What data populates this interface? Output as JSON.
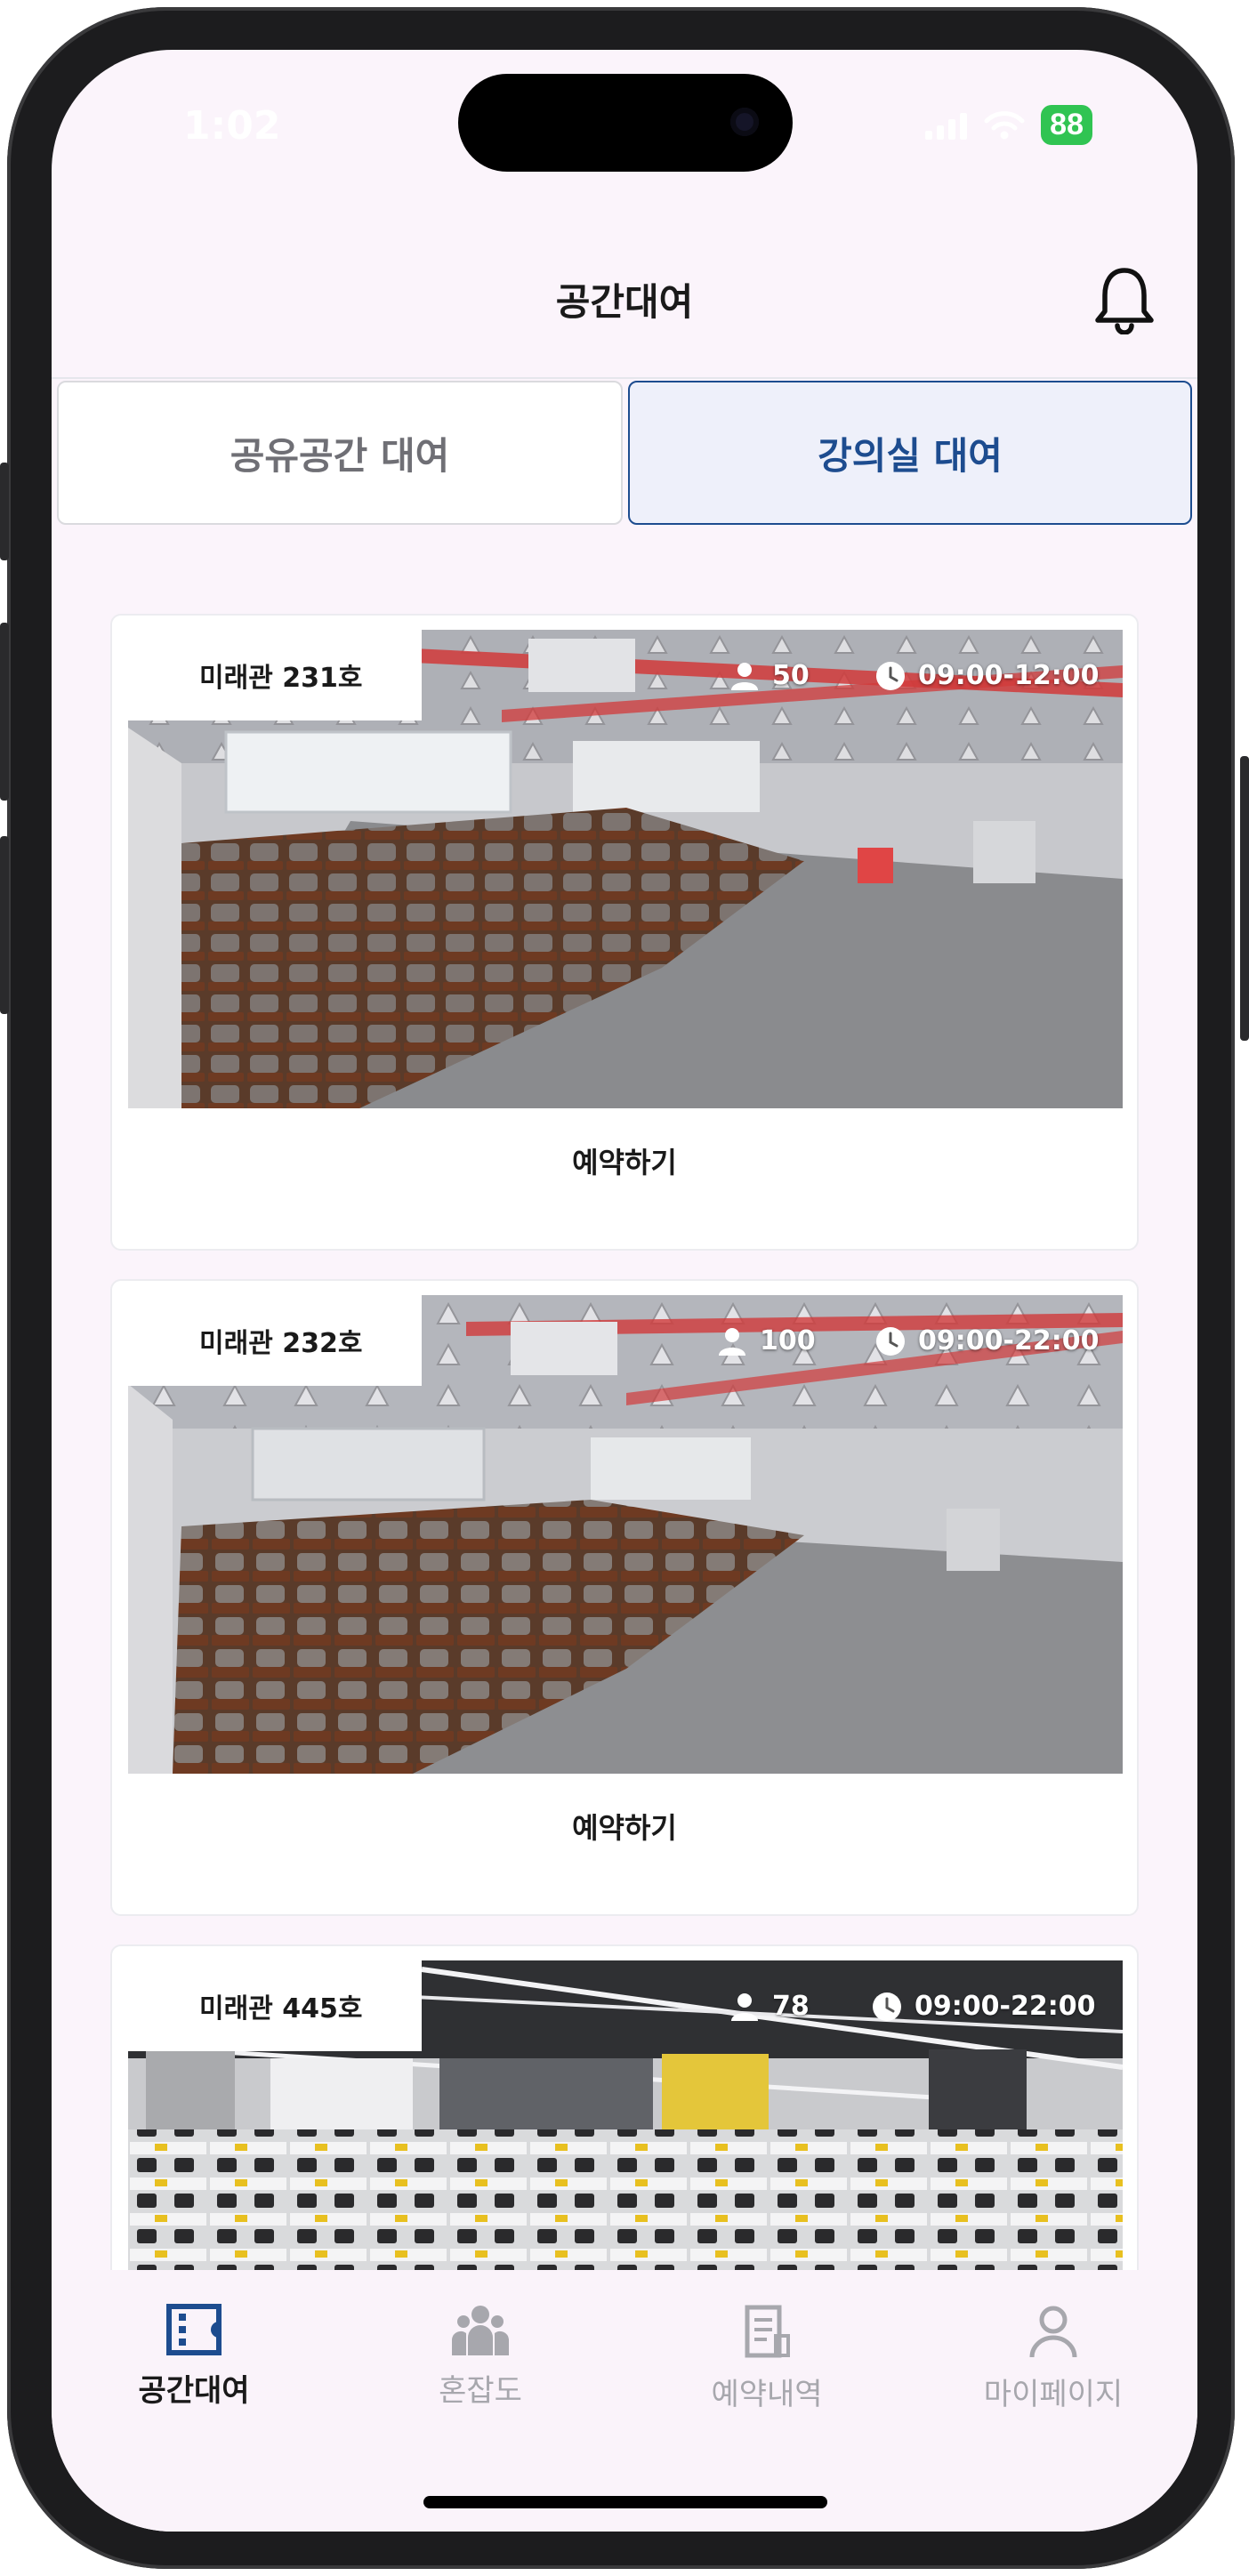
{
  "status": {
    "time": "1:02",
    "battery": "88"
  },
  "header": {
    "title": "공간대여"
  },
  "tabs": [
    {
      "label": "공유공간 대여",
      "active": false
    },
    {
      "label": "강의실 대여",
      "active": true
    }
  ],
  "rooms": [
    {
      "name": "미래관 231호",
      "capacity": "50",
      "hours": "09:00-12:00",
      "action": "예약하기"
    },
    {
      "name": "미래관 232호",
      "capacity": "100",
      "hours": "09:00-22:00",
      "action": "예약하기"
    },
    {
      "name": "미래관 445호",
      "capacity": "78",
      "hours": "09:00-22:00"
    }
  ],
  "bottom_nav": [
    {
      "label": "공간대여",
      "icon": "ticket-icon",
      "active": true
    },
    {
      "label": "혼잡도",
      "icon": "people-icon",
      "active": false
    },
    {
      "label": "예약내역",
      "icon": "document-icon",
      "active": false
    },
    {
      "label": "마이페이지",
      "icon": "person-icon",
      "active": false
    }
  ],
  "colors": {
    "accent": "#1d4c8f",
    "screen_bg": "#fbf4fb",
    "inactive": "#a7a7ad",
    "battery": "#30c452"
  }
}
